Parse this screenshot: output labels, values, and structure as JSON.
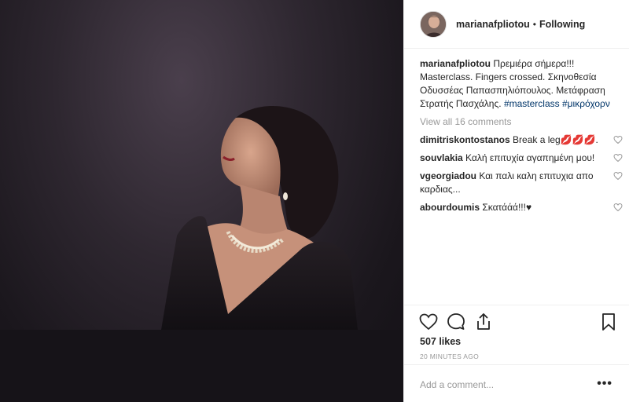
{
  "post": {
    "username": "marianafpliotou",
    "separator": "•",
    "follow_status": "Following"
  },
  "caption": {
    "username": "marianafpliotou",
    "text": " Πρεμιέρα σήμερα!!! Masterclass. Fingers crossed. Σκηνοθεσία Οδυσσέας Παπασπηλιόπουλος. Μετάφραση Στρατής Πασχάλης. ",
    "tag1": "#masterclass",
    "tag2": "#μικρόχορν"
  },
  "view_all": "View all 16 comments",
  "comments": [
    {
      "username": "dimitriskontostanos",
      "text": " Break a leg💋💋💋."
    },
    {
      "username": "souvlakia",
      "text": " Καλή επιτυχία αγαπημένη μου!"
    },
    {
      "username": "vgeorgiadou",
      "text": " Και παλι καλη επιτυχια απο καρδιας..."
    },
    {
      "username": "abourdoumis",
      "text": " Σκατάάά!!!♥"
    }
  ],
  "likes": "507 likes",
  "timestamp": "20 MINUTES AGO",
  "add_comment_placeholder": "Add a comment...",
  "more_label": "•••",
  "icons": {
    "like": "heart-icon",
    "comment": "comment-bubble-icon",
    "share": "share-icon",
    "save": "bookmark-icon",
    "comment_like": "small-heart-icon"
  },
  "colors": {
    "hashtag": "#003569",
    "muted": "#999999",
    "text": "#262626"
  }
}
